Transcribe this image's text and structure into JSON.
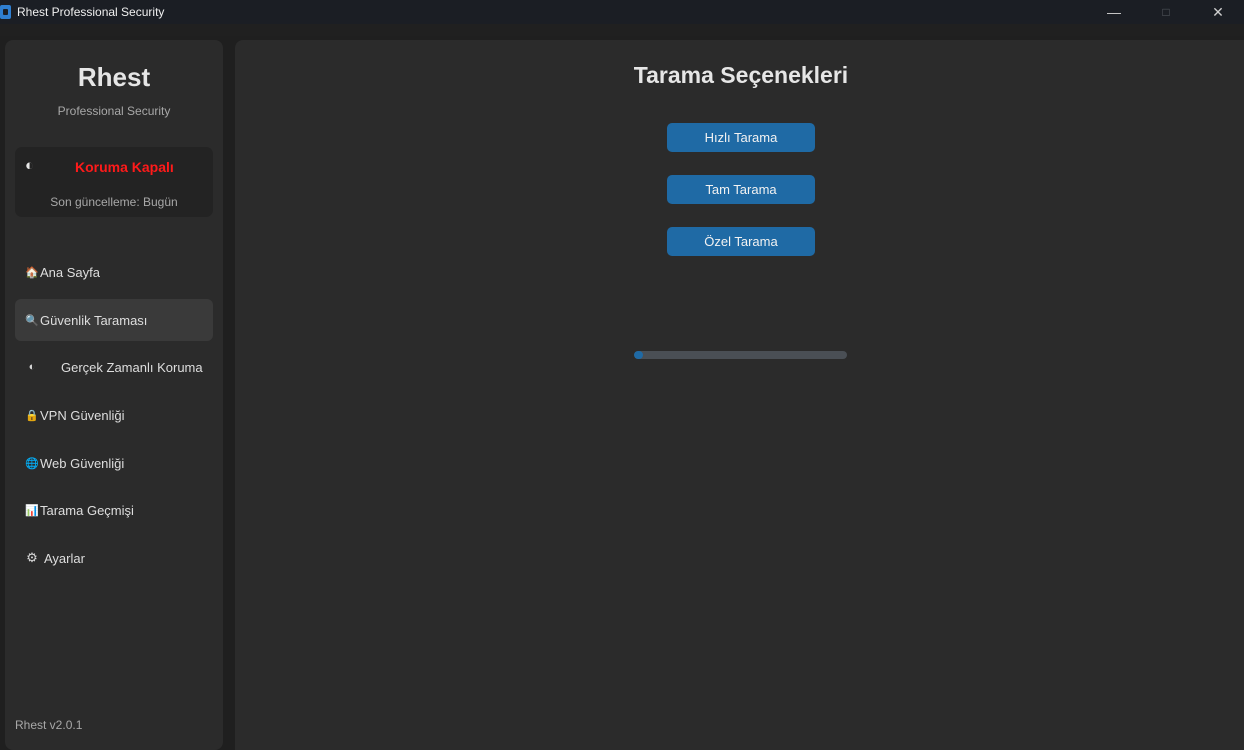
{
  "window": {
    "title": "Rhest Professional Security",
    "controls": {
      "minimize": "—",
      "maximize": "□",
      "close": "✕"
    }
  },
  "sidebar": {
    "brand": "Rhest",
    "tagline": "Professional Security",
    "status": {
      "icon": "shield-half-icon",
      "glyph": "◐",
      "text": "Koruma Kapalı",
      "color": "#ff1a1a",
      "update": "Son güncelleme: Bugün"
    },
    "items": [
      {
        "icon": "house-icon",
        "glyph": "🏠",
        "label": "Ana Sayfa"
      },
      {
        "icon": "magnifier-icon",
        "glyph": "🔍",
        "label": "Güvenlik Taraması"
      },
      {
        "icon": "shield-half-icon",
        "glyph": "◐",
        "label": "Gerçek Zamanlı Koruma"
      },
      {
        "icon": "lock-icon",
        "glyph": "🔒",
        "label": "VPN Güvenliği"
      },
      {
        "icon": "globe-icon",
        "glyph": "🌐",
        "label": "Web Güvenliği"
      },
      {
        "icon": "chart-icon",
        "glyph": "📊",
        "label": "Tarama Geçmişi"
      },
      {
        "icon": "gear-icon",
        "glyph": "⚙",
        "label": "Ayarlar"
      }
    ],
    "active_index": 1,
    "version": "Rhest v2.0.1"
  },
  "main": {
    "title": "Tarama Seçenekleri",
    "buttons": [
      {
        "label": "Hızlı Tarama"
      },
      {
        "label": "Tam Tarama"
      },
      {
        "label": "Özel Tarama"
      }
    ],
    "progress": 0.04
  },
  "colors": {
    "accent": "#1f6aa5",
    "status_off": "#ff1a1a",
    "panel": "#2b2b2b",
    "background": "#1f1f1f"
  }
}
